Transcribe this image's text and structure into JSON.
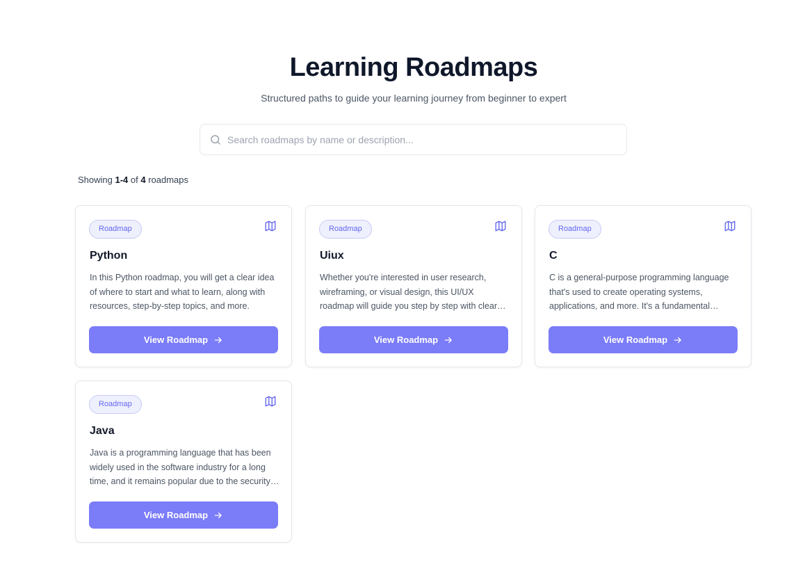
{
  "header": {
    "title": "Learning Roadmaps",
    "subtitle": "Structured paths to guide your learning journey from beginner to expert"
  },
  "search": {
    "placeholder": "Search roadmaps by name or description...",
    "value": "",
    "icon": "search-icon"
  },
  "results": {
    "prefix": "Showing ",
    "range": "1-4",
    "middle": " of ",
    "total": "4",
    "suffix": " roadmaps"
  },
  "cards": [
    {
      "badge": "Roadmap",
      "icon": "map-icon",
      "title": "Python",
      "description": "In this Python roadmap, you will get a clear idea of where to start and what to learn, along with resources, step-by-step topics, and more.",
      "button": "View Roadmap"
    },
    {
      "badge": "Roadmap",
      "icon": "map-icon",
      "title": "Uiux",
      "description": "Whether you're interested in user research, wireframing, or visual design, this UI/UX roadmap will guide you step by step with clear milestones and resources.",
      "button": "View Roadmap"
    },
    {
      "badge": "Roadmap",
      "icon": "map-icon",
      "title": "C",
      "description": "C is a general-purpose programming language that's used to create operating systems, applications, and more. It's a fundamental language for every programmer.",
      "button": "View Roadmap"
    },
    {
      "badge": "Roadmap",
      "icon": "map-icon",
      "title": "Java",
      "description": "Java is a programming language that has been widely used in the software industry for a long time, and it remains popular due to the security and portability it offers.",
      "button": "View Roadmap"
    }
  ],
  "colors": {
    "accent": "#7b7cf8",
    "badge_bg": "#eef0fd",
    "badge_text": "#6366f1",
    "title": "#0f172a",
    "body_text": "#4b5563"
  }
}
